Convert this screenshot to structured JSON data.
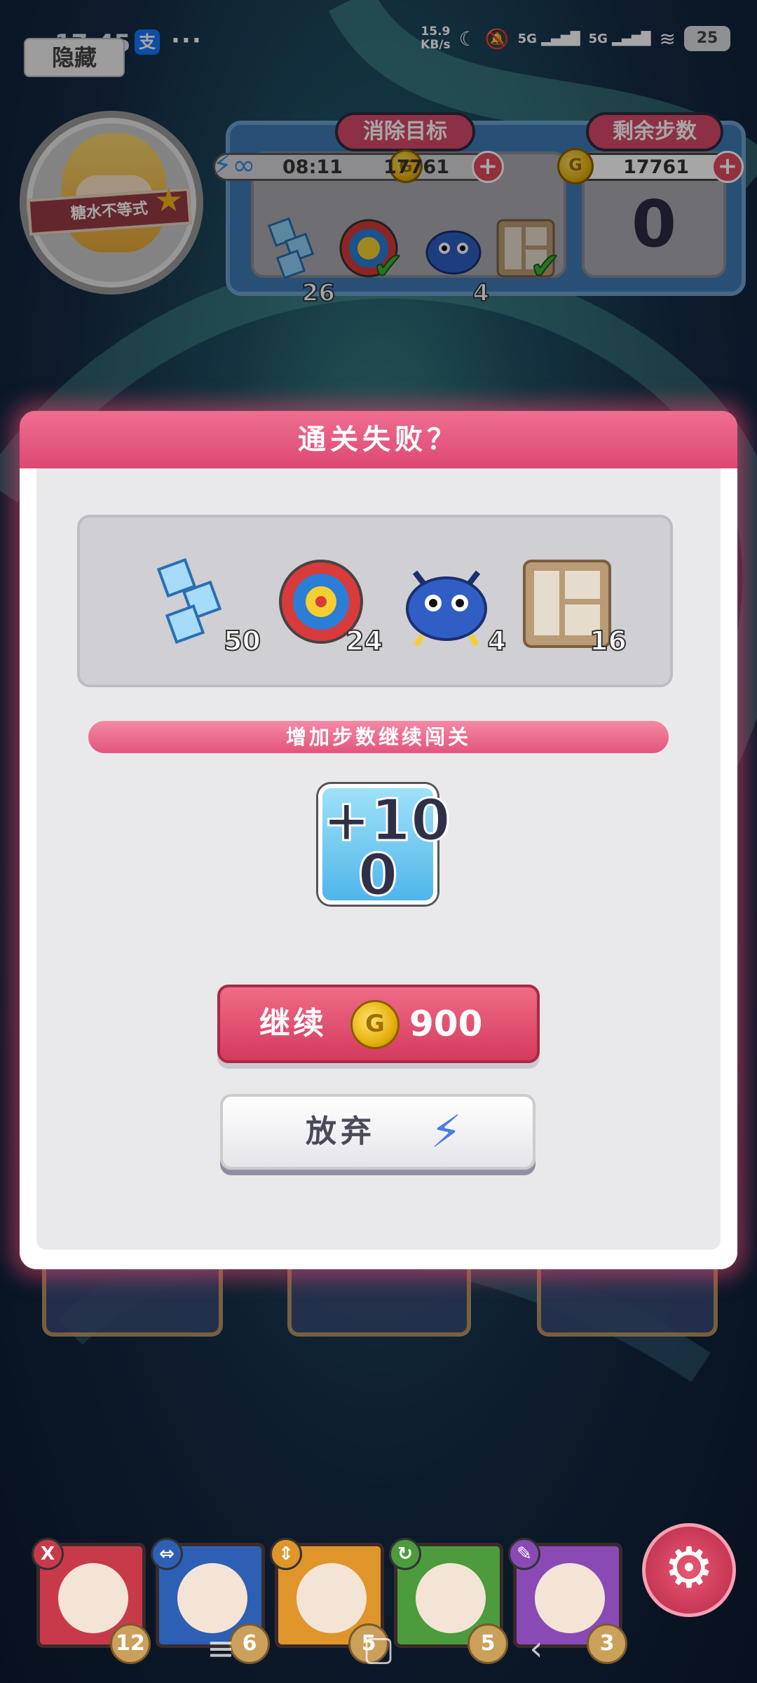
{
  "status_bar": {
    "time": "17:45",
    "net_speed_value": "15.9",
    "net_speed_unit": "KB/s",
    "signal_1": "5G",
    "signal_2": "5G",
    "battery": "25"
  },
  "hide_button": "隐藏",
  "character": {
    "name": "糖水不等式"
  },
  "hud": {
    "goal_tag": "消除目标",
    "steps_tag": "剩余步数",
    "timer": "08:11",
    "coins": "17761",
    "coins_2": "17761",
    "remaining_steps": "0",
    "goals": [
      {
        "icon": "ice-cube-icon",
        "count": "26"
      },
      {
        "icon": "target-icon",
        "count": "",
        "done": true
      },
      {
        "icon": "blue-crab-icon",
        "count": "4"
      },
      {
        "icon": "stone-block-icon",
        "count": "",
        "done": true
      }
    ]
  },
  "modal": {
    "title": "通关失败？",
    "goals": [
      {
        "icon": "ice-cube-icon",
        "count": "50"
      },
      {
        "icon": "target-icon",
        "count": "24"
      },
      {
        "icon": "blue-crab-icon",
        "count": "4"
      },
      {
        "icon": "stone-block-icon",
        "count": "16"
      }
    ],
    "ribbon": "增加步数继续闯关",
    "boost": "+10\n0",
    "continue_label": "继续",
    "continue_price": "900",
    "quit_label": "放弃"
  },
  "heroes": [
    {
      "count": "12",
      "color": "#c83a4a",
      "icon": "X"
    },
    {
      "count": "6",
      "color": "#2d5fb5",
      "icon": "⇔"
    },
    {
      "count": "5",
      "color": "#e0952a",
      "icon": "⇕"
    },
    {
      "count": "5",
      "color": "#4c9b3c",
      "icon": "↻"
    },
    {
      "count": "3",
      "color": "#8a4ab5",
      "icon": "✎"
    }
  ],
  "colors": {
    "accent": "#dd4872",
    "hud_blue": "#3e7bb6",
    "modal_bg": "#e9e9ec"
  }
}
